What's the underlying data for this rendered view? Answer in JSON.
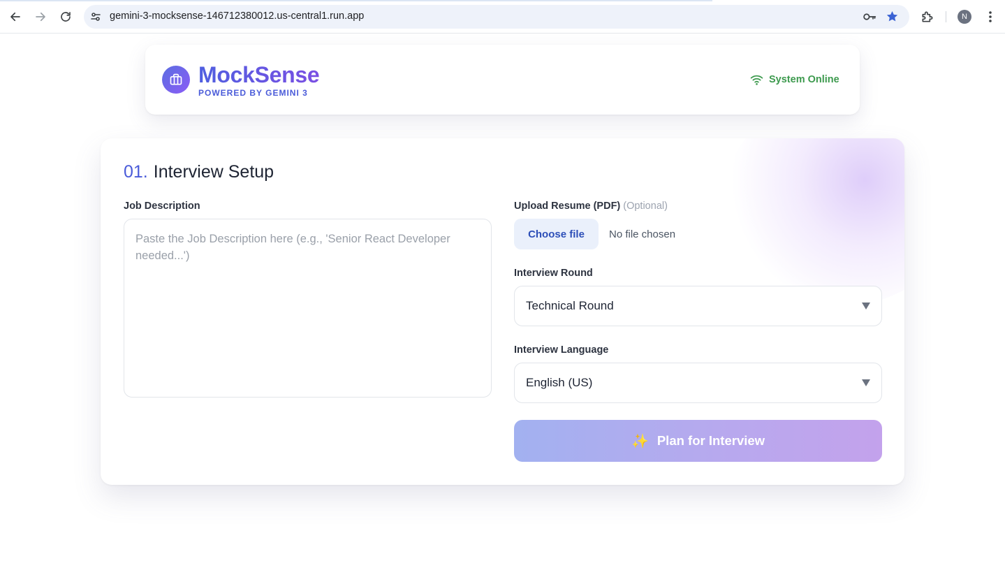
{
  "browser": {
    "url": "gemini-3-mocksense-146712380012.us-central1.run.app",
    "profile_initial": "N"
  },
  "header": {
    "brand_name": "MockSense",
    "brand_tagline": "POWERED BY GEMINI 3",
    "status_text": "System Online",
    "brand_color": "#4f5fe0",
    "status_color": "#3d9a4e"
  },
  "setup": {
    "section_number": "01.",
    "section_title": "Interview Setup",
    "job_description": {
      "label": "Job Description",
      "value": "",
      "placeholder": "Paste the Job Description here (e.g., 'Senior React Developer needed...')"
    },
    "resume": {
      "label": "Upload Resume (PDF)",
      "optional_note": "(Optional)",
      "button_label": "Choose file",
      "file_status": "No file chosen"
    },
    "round": {
      "label": "Interview Round",
      "selected": "Technical Round"
    },
    "language": {
      "label": "Interview Language",
      "selected": "English (US)"
    },
    "submit": {
      "icon": "sparkles-icon",
      "label": "Plan for Interview"
    }
  }
}
